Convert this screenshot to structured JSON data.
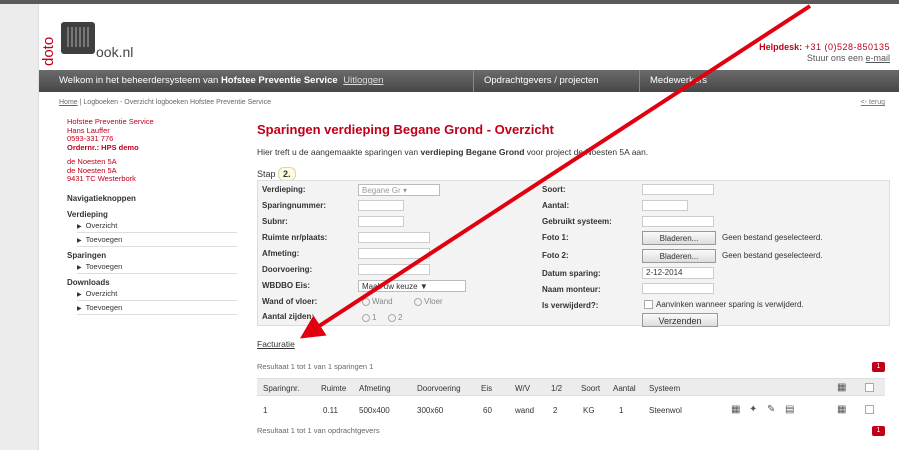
{
  "header": {
    "logo_side": "doto",
    "logo_text": "ook.nl",
    "helpdesk_label": "Helpdesk:",
    "helpdesk_phone": "+31 (0)528-850135",
    "mail_prefix": "Stuur ons een",
    "mail_link": "e-mail"
  },
  "nav": {
    "welcome_text": "Welkom in het beheerdersysteem van",
    "company": "Hofstee Preventie Service",
    "logout": "Uitloggen",
    "tab_clients": "Opdrachtgevers / projecten",
    "tab_staff": "Medewerkers"
  },
  "breadcrumb": {
    "home": "Home",
    "rest": "Logboeken - Overzicht logboeken Hofstee Preventie Service",
    "back": "<- terug"
  },
  "sidebar": {
    "client_name": "Hofstee Preventie Service",
    "contact": "Hans Lauffer",
    "phone": "0593-331 776",
    "order": "Ordernr.: HPS demo",
    "addr1": "de Noesten 5A",
    "addr2": "de Noesten 5A",
    "addr3": "9431 TC Westerbork",
    "nav_heading": "Navigatieknoppen",
    "sec1": "Verdieping",
    "sec1_items": [
      "Overzicht",
      "Toevoegen"
    ],
    "sec2": "Sparingen",
    "sec2_items": [
      "Toevoegen"
    ],
    "sec3": "Downloads",
    "sec3_items": [
      "Overzicht",
      "Toevoegen"
    ]
  },
  "main": {
    "title": "Sparingen verdieping Begane Grond - Overzicht",
    "intro_pre": "Hier treft u de aangemaakte sparingen van",
    "intro_bold": "verdieping Begane Grond",
    "intro_post": "voor project de Noesten 5A aan.",
    "stap_label": "Stap",
    "stap_num": "2."
  },
  "form": {
    "verdieping_label": "Verdieping:",
    "verdieping_value": "Begane Gr",
    "sparingnummer_label": "Sparingnummer:",
    "subnr_label": "Subnr:",
    "ruimte_label": "Ruimte nr/plaats:",
    "afmeting_label": "Afmeting:",
    "doorvoering_label": "Doorvoering:",
    "wbdbo_label": "WBDBO Eis:",
    "wbdbo_value": "Maak uw keuze",
    "wand_label": "Wand of vloer:",
    "wand_opt1": "Wand",
    "wand_opt2": "Vloer",
    "zijden_label": "Aantal zijden:",
    "zijden_opt1": "1",
    "zijden_opt2": "2",
    "soort_label": "Soort:",
    "aantal_label": "Aantal:",
    "systeem_label": "Gebruikt systeem:",
    "foto1_label": "Foto 1:",
    "foto2_label": "Foto 2:",
    "browse": "Bladeren...",
    "no_file": "Geen bestand geselecteerd.",
    "datum_label": "Datum sparing:",
    "datum_value": "2-12-2014",
    "monteur_label": "Naam monteur:",
    "verwijderd_label": "Is verwijderd?:",
    "verwijderd_note": "Aanvinken wanneer sparing is verwijderd.",
    "submit": "Verzenden"
  },
  "facturatie": "Facturatie",
  "results": {
    "top": "Resultaat 1 tot 1 van 1 sparingen 1",
    "bottom": "Resultaat 1 tot 1 van opdrachtgevers",
    "page": "1"
  },
  "table": {
    "headers": [
      "Sparingnr.",
      "Ruimte",
      "Afmeting",
      "Doorvoering",
      "Eis",
      "W/V",
      "1/2",
      "Soort",
      "Aantal",
      "Systeem"
    ],
    "row": [
      "1",
      "0.11",
      "500x400",
      "300x60",
      "60",
      "wand",
      "2",
      "KG",
      "1",
      "Steenwol"
    ]
  },
  "colors": {
    "accent": "#c0001a",
    "nav": "#555555",
    "arrow": "#e0000f"
  }
}
